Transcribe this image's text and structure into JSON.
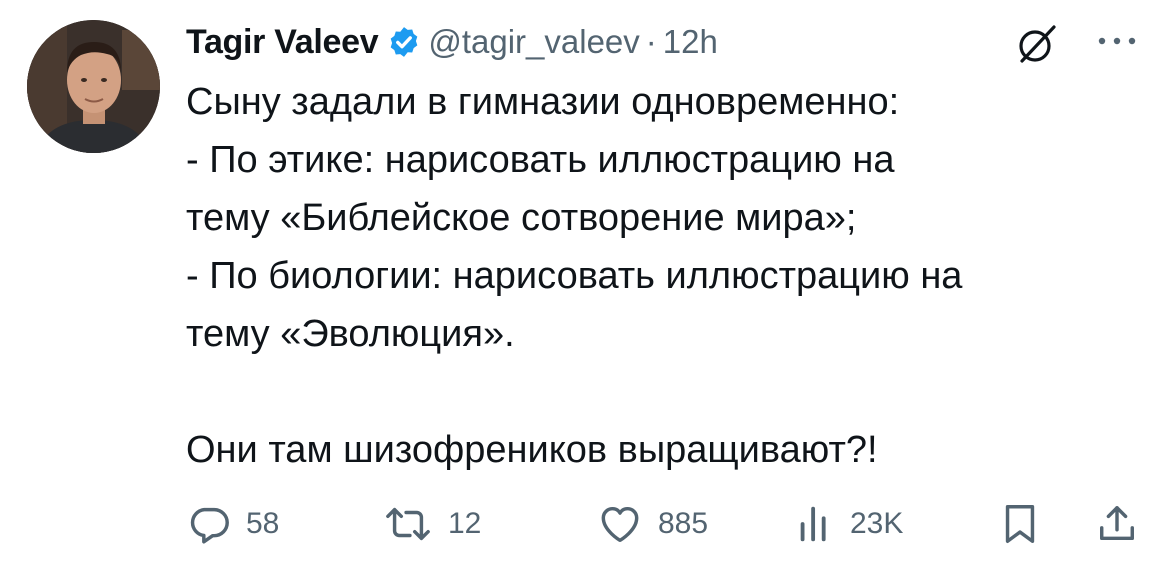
{
  "author": {
    "display_name": "Tagir Valeev",
    "handle": "@tagir_valeev",
    "separator": "·",
    "time": "12h",
    "verified": true
  },
  "tweet": {
    "lines": [
      "Сыну задали в гимназии одновременно:",
      "- По этике: нарисовать иллюстрацию на",
      "тему «Библейское сотворение мира»;",
      "- По биологии: нарисовать иллюстрацию на",
      "тему «Эволюция».",
      "",
      "Они там шизофреников выращивают?!"
    ]
  },
  "actions": {
    "replies": "58",
    "retweets": "12",
    "likes": "885",
    "views": "23K"
  },
  "icons": {
    "verified": "verified-badge-icon",
    "grok": "grok-icon",
    "more": "more-icon",
    "reply": "reply-icon",
    "retweet": "retweet-icon",
    "like": "heart-icon",
    "views": "views-icon",
    "bookmark": "bookmark-icon",
    "share": "share-icon"
  },
  "colors": {
    "text": "#0f1419",
    "secondary": "#536471",
    "verified": "#1d9bf0"
  }
}
